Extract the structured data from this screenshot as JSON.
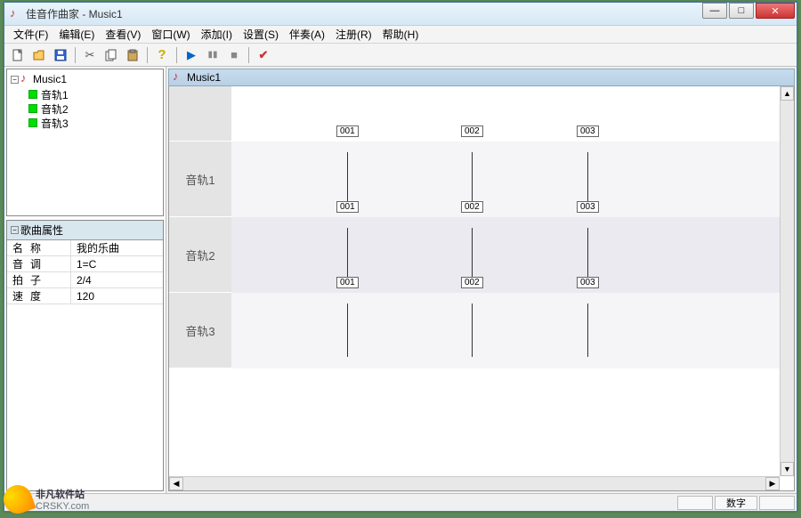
{
  "app": {
    "title": "佳音作曲家 - Music1"
  },
  "menu": {
    "file": "文件(F)",
    "edit": "编辑(E)",
    "view": "查看(V)",
    "window": "窗口(W)",
    "insert": "添加(I)",
    "settings": "设置(S)",
    "accompany": "伴奏(A)",
    "register": "注册(R)",
    "help": "帮助(H)"
  },
  "toolbar": {
    "new": "new-file",
    "open": "open-file",
    "save": "save-file",
    "cut": "cut",
    "copy": "copy",
    "paste": "paste",
    "help": "help",
    "play": "play",
    "pause": "pause",
    "stop": "stop",
    "check": "check"
  },
  "tree": {
    "root": "Music1",
    "items": [
      "音轨1",
      "音轨2",
      "音轨3"
    ]
  },
  "props": {
    "title": "歌曲属性",
    "rows": [
      {
        "k": "名称",
        "v": "我的乐曲"
      },
      {
        "k": "音调",
        "v": "1=C"
      },
      {
        "k": "拍子",
        "v": "2/4"
      },
      {
        "k": "速度",
        "v": "120"
      }
    ]
  },
  "document": {
    "title": "Music1",
    "tracks": [
      "音轨1",
      "音轨2",
      "音轨3"
    ],
    "measures": [
      "001",
      "002",
      "003"
    ]
  },
  "statusbar": {
    "mode": "数字"
  },
  "watermark": {
    "line1": "非凡软件站",
    "line2": "CRSKY.com"
  }
}
